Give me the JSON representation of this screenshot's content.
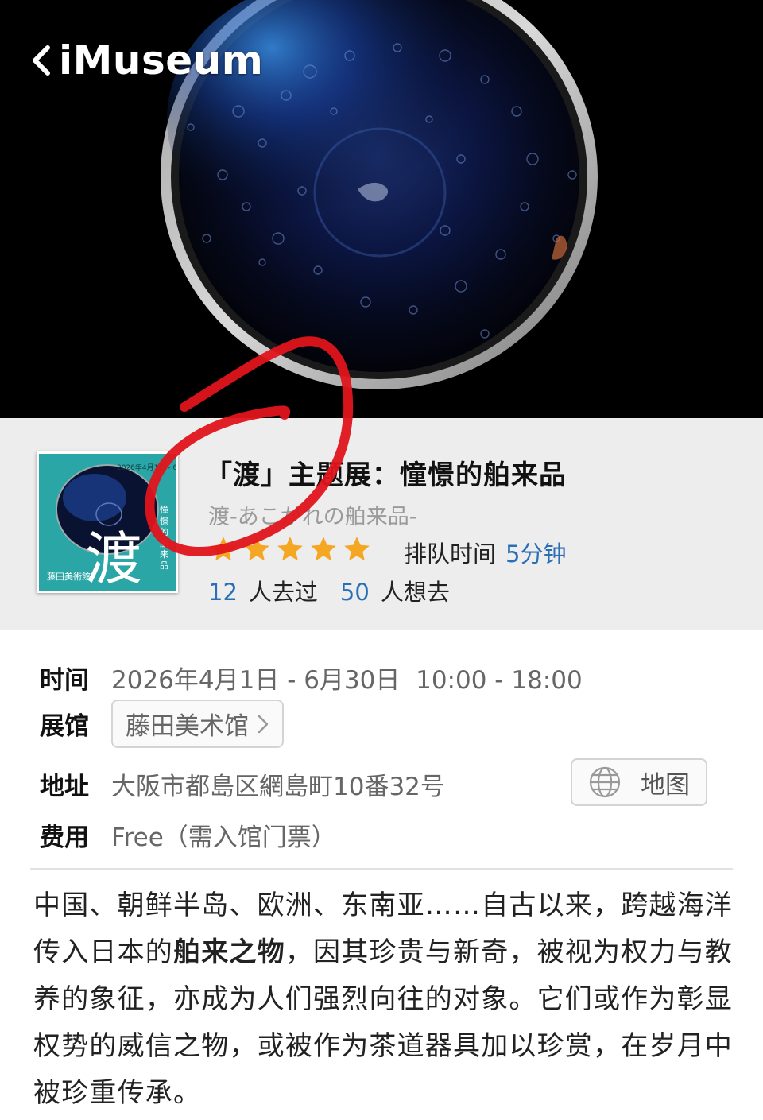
{
  "nav": {
    "back_title": "iMuseum"
  },
  "exhibition": {
    "title": "「渡」主题展：憧憬的舶来品",
    "subtitle": "渡-あこがれの舶来品-",
    "rating": 5,
    "queue_label": "排队时间",
    "queue_value": "5分钟",
    "visited_count": "12",
    "visited_label": "人去过",
    "want_count": "50",
    "want_label": "人想去"
  },
  "poster": {
    "date_text": "2026年4月1日 - 6月30日",
    "big_char": "渡",
    "brand": "藤田美術館",
    "side_text": "憧憬的舶来品"
  },
  "details": {
    "time_label": "时间",
    "time_value": "2026年4月1日 - 6月30日  10:00 - 18:00",
    "venue_label": "展馆",
    "venue_value": "藤田美术馆",
    "address_label": "地址",
    "address_value": "大阪市都島区網島町10番32号",
    "map_button": "地图",
    "fee_label": "费用",
    "fee_value": "Free（需入馆门票）"
  },
  "description": {
    "before": "中国、朝鲜半岛、欧洲、东南亚……自古以来，跨越海洋传入日本的",
    "bold": "舶来之物",
    "after": "，因其珍贵与新奇，被视为权力与教养的象征，亦成为人们强烈向往的对象。它们或作为彰显权势的威信之物，或被作为茶道器具加以珍赏，在岁月中被珍重传承。"
  },
  "colors": {
    "accent_blue": "#2a6fb6",
    "star": "#f5a623",
    "band_bg": "#ededed",
    "annotation_red": "#e0141b",
    "poster_teal": "#2aa6a6"
  },
  "icons": {
    "back": "chevron-left-icon",
    "star": "star-icon",
    "venue_chevron": "chevron-right-icon",
    "map": "globe-icon"
  }
}
